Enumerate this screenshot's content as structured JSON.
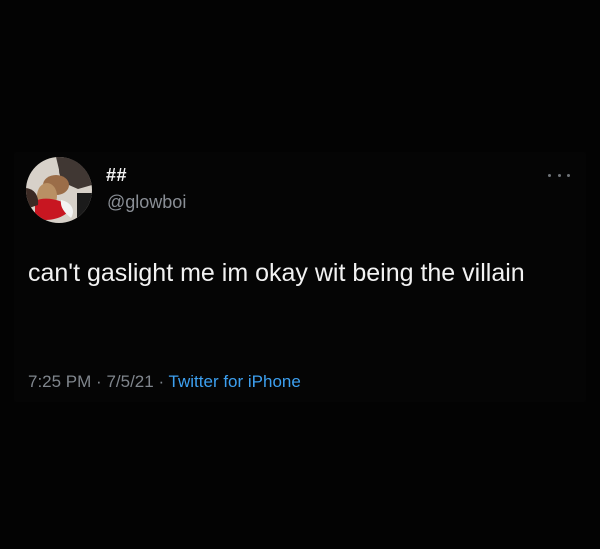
{
  "tweet": {
    "display_name": "##",
    "handle": "@glowboi",
    "text": "can't gaslight me im okay wit being the villain",
    "time": "7:25 PM",
    "separator": "·",
    "date": "7/5/21",
    "source": "Twitter for iPhone"
  },
  "icons": {
    "more": "more-options-icon",
    "avatar": "profile-avatar-image"
  },
  "colors": {
    "background": "#030303",
    "text_primary": "#f2f2f2",
    "text_secondary": "#80868d",
    "link": "#3da0f0"
  }
}
